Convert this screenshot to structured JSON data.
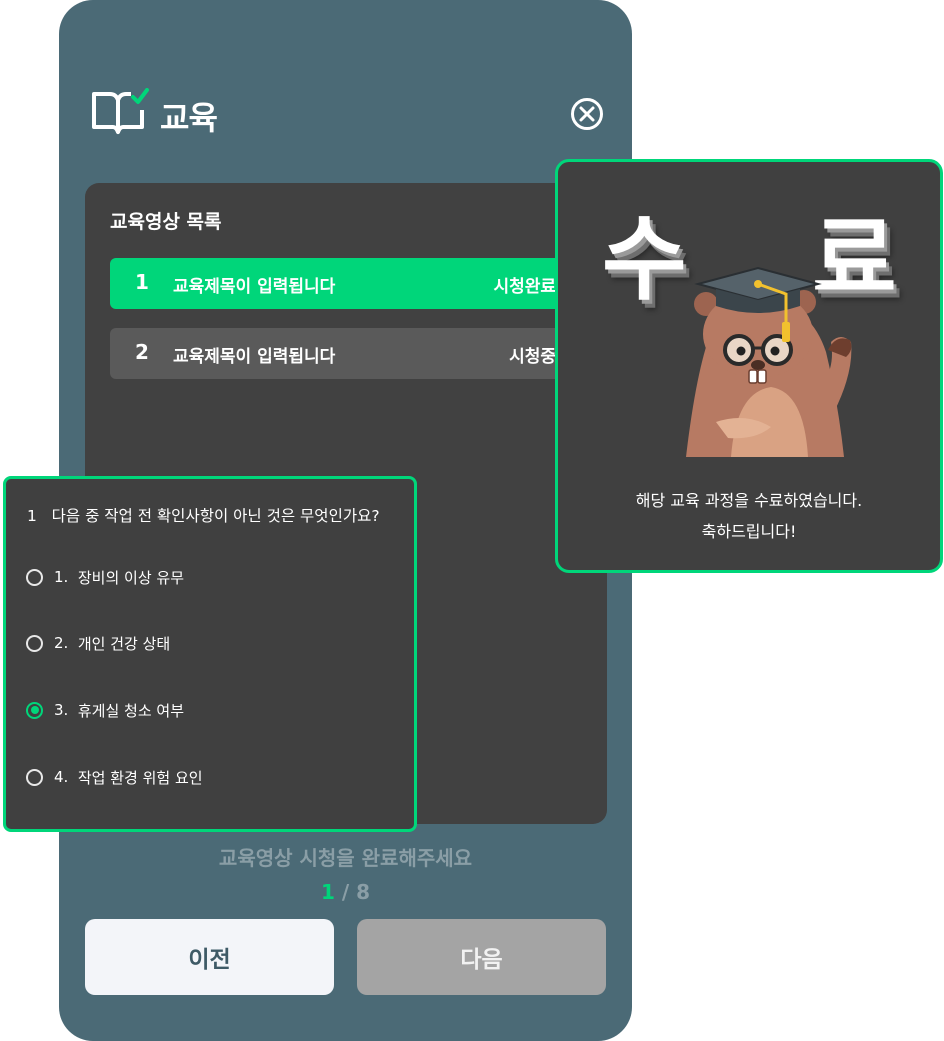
{
  "header": {
    "title": "교육",
    "icon": "book-check-icon",
    "close_icon": "close-circle-icon"
  },
  "video_list": {
    "title": "교육영상 목록",
    "items": [
      {
        "number": "1",
        "title": "교육제목이 입력됩니다",
        "status": "시청완료"
      },
      {
        "number": "2",
        "title": "교육제목이 입력됩니다",
        "status": "시청중"
      }
    ]
  },
  "notice": "교육영상 시청을 완료해주세요",
  "pager": {
    "current": "1",
    "separator": "/",
    "total": "8"
  },
  "buttons": {
    "prev": "이전",
    "next": "다음"
  },
  "quiz": {
    "number": "1",
    "question": "다음 중 작업 전 확인사항이 아닌 것은 무엇인가요?",
    "options": [
      {
        "number": "1.",
        "label": "장비의 이상 유무",
        "selected": false
      },
      {
        "number": "2.",
        "label": "개인 건강 상태",
        "selected": false
      },
      {
        "number": "3.",
        "label": "휴게실 청소 여부",
        "selected": true
      },
      {
        "number": "4.",
        "label": "작업 환경 위험 요인",
        "selected": false
      }
    ]
  },
  "completion": {
    "char_left": "수",
    "char_right": "료",
    "message_line1": "해당 교육 과정을 수료하였습니다.",
    "message_line2": "축하드립니다!",
    "mascot": "beaver-graduate-illustration"
  },
  "colors": {
    "panel": "#4b6a76",
    "card": "#414141",
    "accent": "#00d67a",
    "item_inactive": "#5a5a5a",
    "button_disabled": "#a4a4a4",
    "button_light": "#f3f5f9"
  }
}
